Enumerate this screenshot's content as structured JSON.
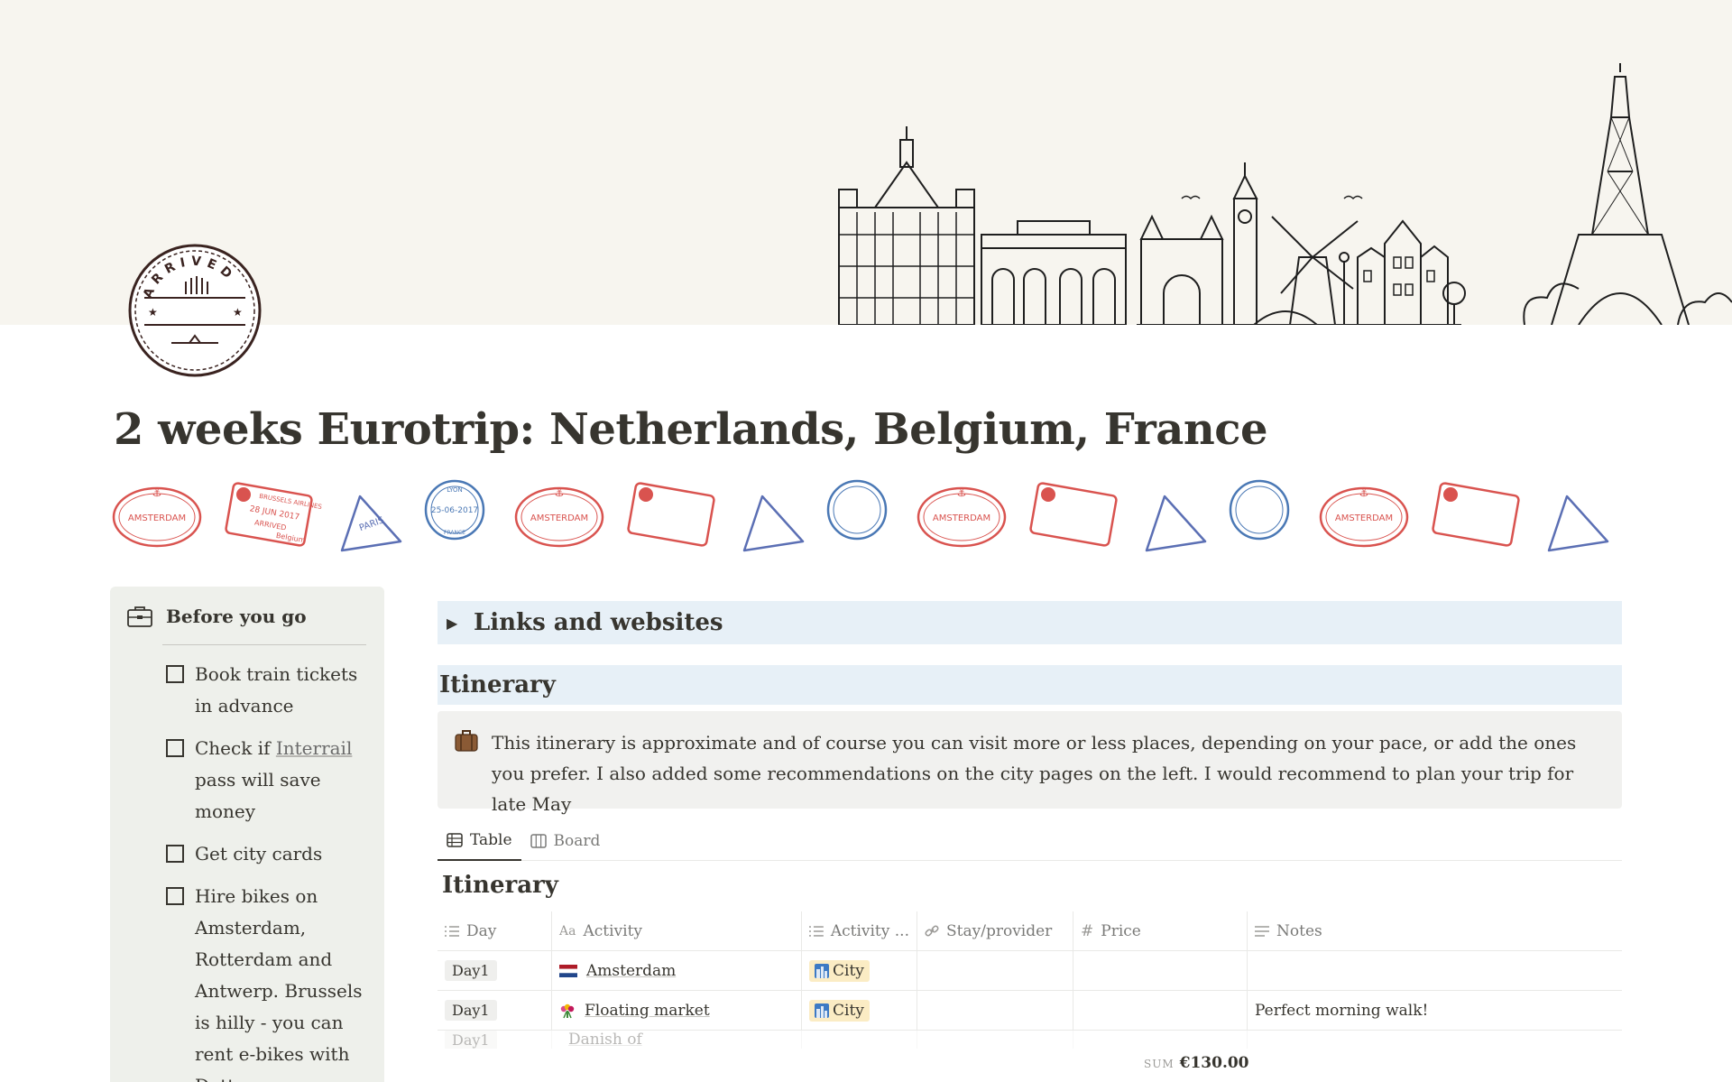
{
  "page": {
    "title": "2 weeks Eurotrip: Netherlands, Belgium, France"
  },
  "cover": {
    "icon": "skyline-illustration"
  },
  "page_icon": {
    "text": "ARRIVED",
    "icon": "arrived-stamp-icon"
  },
  "stamps": {
    "amsterdam": "AMSTERDAM",
    "brussels": "BRUSSELS AIRLINES",
    "brussels_date": "28 JUN 2017",
    "brussels_arrived": "ARRIVED",
    "brussels_city": "Belgium",
    "paris": "PARIS",
    "lyon": "LYON",
    "lyon_date": "25-06-2017",
    "lyon_country": "FRANCE"
  },
  "sidebar": {
    "icon": "briefcase-icon",
    "title": "Before you go",
    "todos": [
      {
        "text": "Book train tickets in advance"
      },
      {
        "pre": "Check if ",
        "link": "Interrail",
        "post": " pass will save money"
      },
      {
        "text": "Get city cards"
      },
      {
        "text": "Hire bikes on Amsterdam, Rotterdam and Antwerp. Brussels is hilly - you can rent e-bikes with Dott - same you"
      }
    ]
  },
  "toggle": {
    "arrow": "▶",
    "label": "Links and websites"
  },
  "itinerary_heading": "Itinerary",
  "callout": {
    "icon": "suitcase-icon",
    "text": "This itinerary is approximate and of course you can visit more or less places, depending on your pace, or add the ones you prefer. I also added some recommendations on the city pages on the left. I would recommend to plan your trip for late May"
  },
  "tabs": [
    {
      "label": "Table",
      "icon": "table-icon",
      "active": true
    },
    {
      "label": "Board",
      "icon": "board-icon",
      "active": false
    }
  ],
  "database": {
    "title": "Itinerary",
    "columns": [
      {
        "label": "Day",
        "icon": "list-icon"
      },
      {
        "label": "Activity",
        "icon": "text-aa-icon"
      },
      {
        "label": "Activity ...",
        "icon": "list-icon"
      },
      {
        "label": "Stay/provider",
        "icon": "link-icon"
      },
      {
        "label": "Price",
        "icon": "hash-icon"
      },
      {
        "label": "Notes",
        "icon": "lines-icon"
      }
    ],
    "rows": [
      {
        "day": "Day1",
        "activity_icon": "netherlands-flag-icon",
        "activity": "Amsterdam",
        "type_icon": "cityscape-icon",
        "type": "City",
        "stay": "",
        "price": "",
        "notes": ""
      },
      {
        "day": "Day1",
        "activity_icon": "tulip-bouquet-icon",
        "activity": "Floating market",
        "type_icon": "cityscape-icon",
        "type": "City",
        "stay": "",
        "price": "",
        "notes": "Perfect morning walk!"
      }
    ],
    "partial_row": {
      "day": "Day1",
      "activity": "Danish of"
    },
    "sum_label": "SUM",
    "sum_value": "€130.00"
  },
  "colors": {
    "cover_bg": "#f7f5ef",
    "sidebar_bg": "#eef0eb",
    "heading_bg": "#e7f0f7",
    "callout_bg": "#f1f1ef",
    "city_tag": "#fbecc4",
    "stamp_red": "#d9534f",
    "stamp_blue": "#5b6fb4",
    "text": "#37352f"
  }
}
